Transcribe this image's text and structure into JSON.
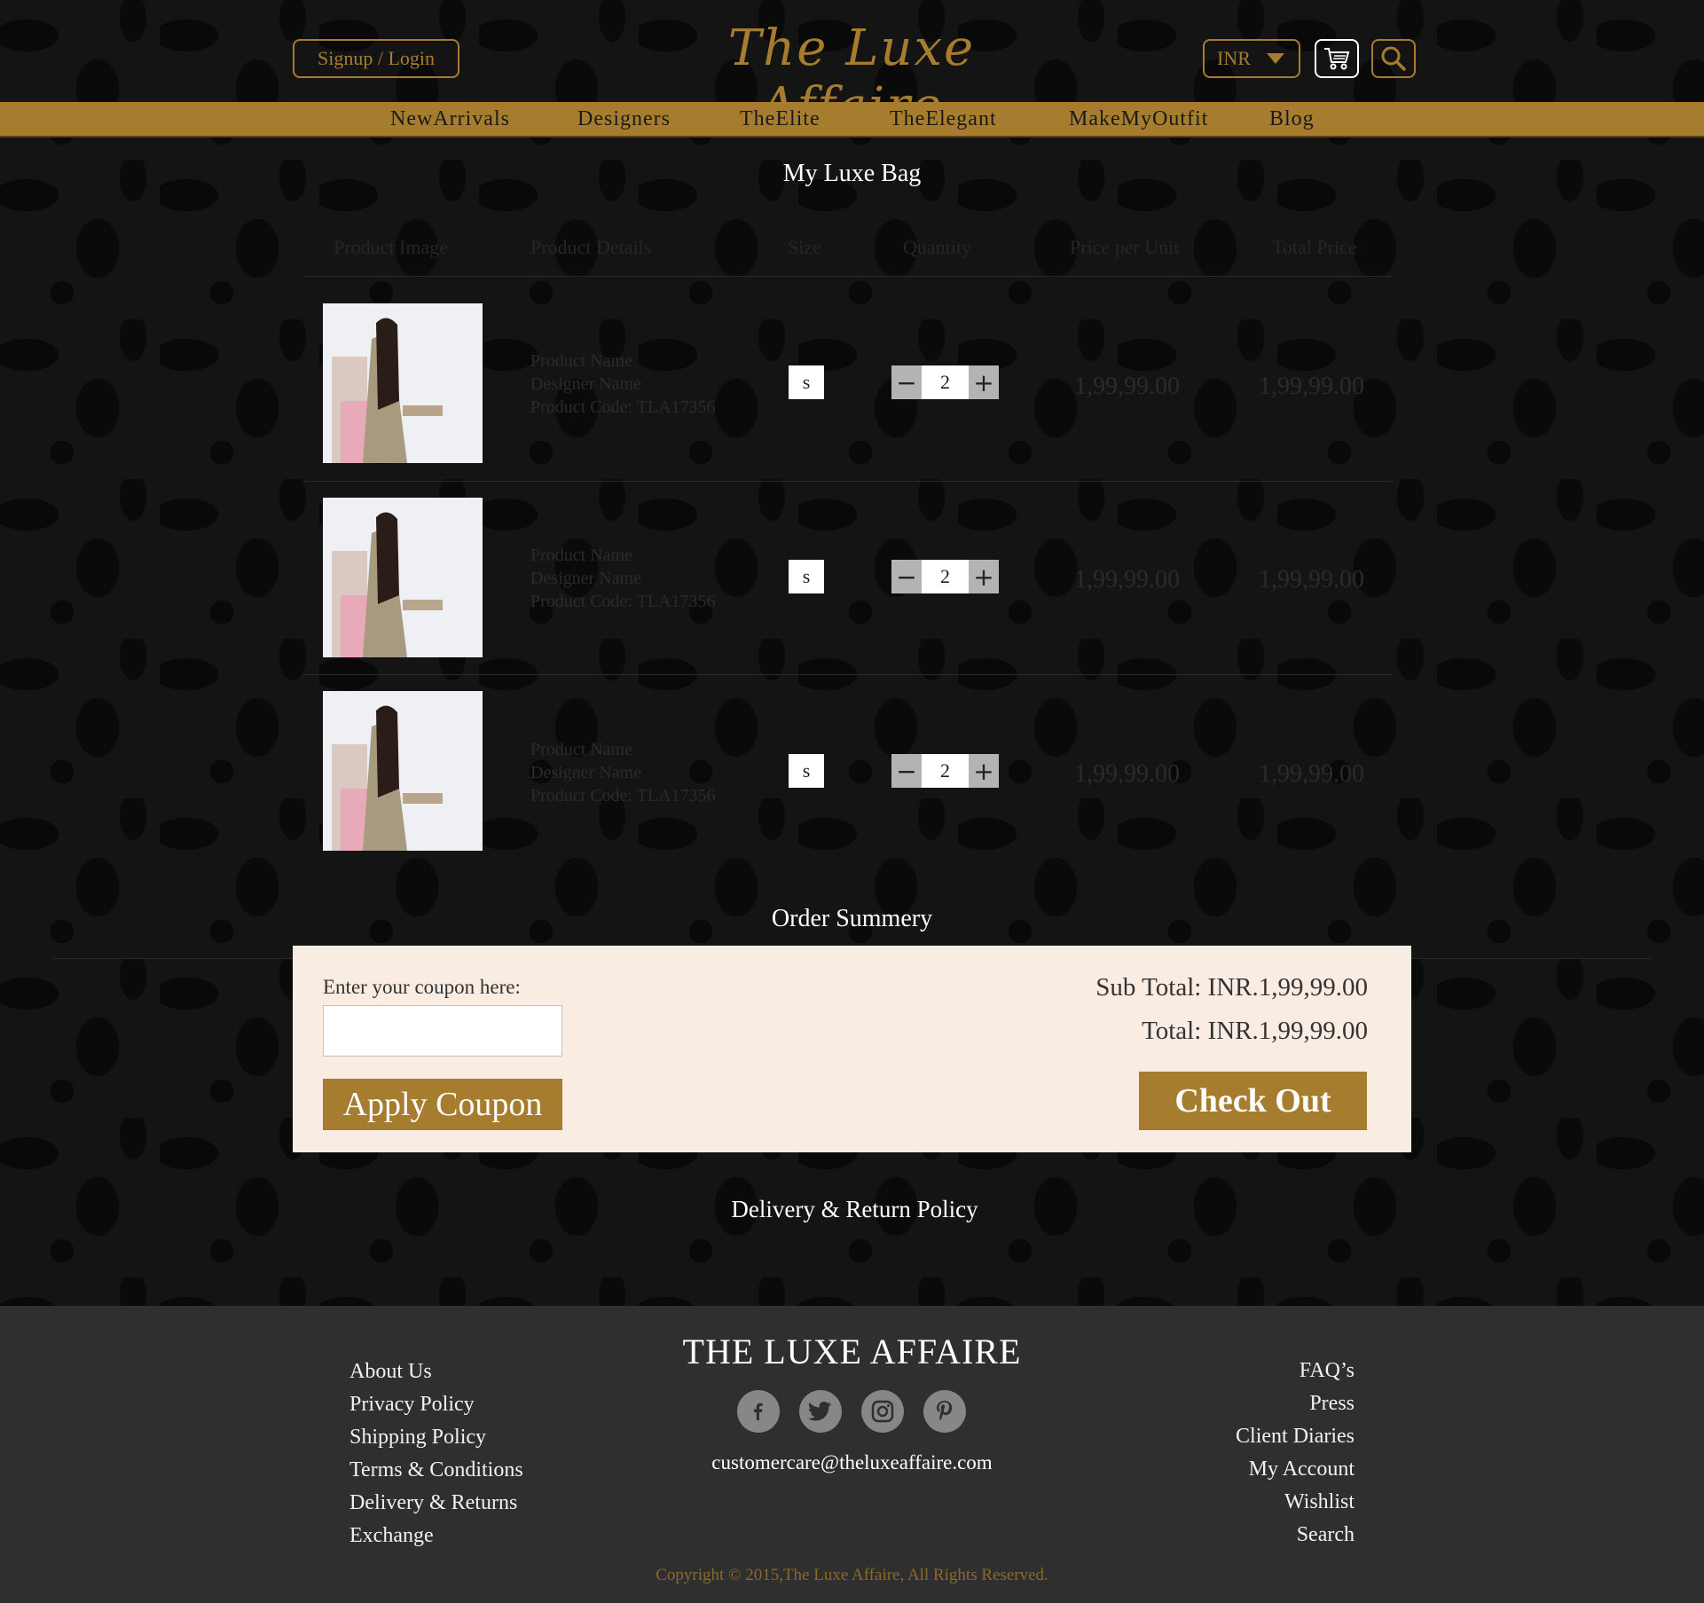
{
  "header": {
    "login_label": "Signup / Login",
    "logo": "The Luxe Affaire",
    "currency": "INR"
  },
  "nav": [
    "NewArrivals",
    "Designers",
    "TheElite",
    "TheElegant",
    "MakeMyOutfit",
    "Blog"
  ],
  "bag": {
    "title": "My Luxe Bag",
    "columns": [
      "Product Image",
      "Product Details",
      "Size",
      "Quantity",
      "Price per Unit",
      "Total Price"
    ],
    "items": [
      {
        "name": "Product Name",
        "designer": "Designer Name",
        "code": "Product Code: TLA17356",
        "size": "s",
        "quantity": "2",
        "unit_price": "1,99,99.00",
        "total_price": "1,99,99.00"
      },
      {
        "name": "Product Name",
        "designer": "Designer Name",
        "code": "Product Code: TLA17356",
        "size": "s",
        "quantity": "2",
        "unit_price": "1,99,99.00",
        "total_price": "1,99,99.00"
      },
      {
        "name": "Product Name",
        "designer": "Designer Name",
        "code": "Product Code: TLA17356",
        "size": "s",
        "quantity": "2",
        "unit_price": "1,99,99.00",
        "total_price": "1,99,99.00"
      }
    ],
    "minus": "−",
    "plus": "+"
  },
  "summary": {
    "title": "Order Summery",
    "coupon_label": "Enter your coupon here:",
    "coupon_value": "",
    "apply_label": "Apply Coupon",
    "subtotal": "Sub Total: INR.1,99,99.00",
    "total": "Total: INR.1,99,99.00",
    "checkout_label": "Check Out"
  },
  "policy": "Delivery & Return Policy",
  "footer": {
    "brand": "THE LUXE AFFAIRE",
    "left_links": [
      "About Us",
      "Privacy Policy",
      "Shipping Policy",
      "Terms & Conditions",
      "Delivery & Returns",
      "Exchange"
    ],
    "right_links": [
      "FAQ’s",
      "Press",
      "Client Diaries",
      "My Account",
      "Wishlist",
      "Search"
    ],
    "social": [
      "facebook-icon",
      "twitter-icon",
      "instagram-icon",
      "pinterest-icon"
    ],
    "email": "customercare@theluxeaffaire.com",
    "copyright": "Copyright © 2015,The Luxe Affaire, All Rights Reserved."
  },
  "colors": {
    "accent": "#a67c2e",
    "summary_bg": "#f9ece2",
    "footer_bg": "#2f2f2f"
  }
}
